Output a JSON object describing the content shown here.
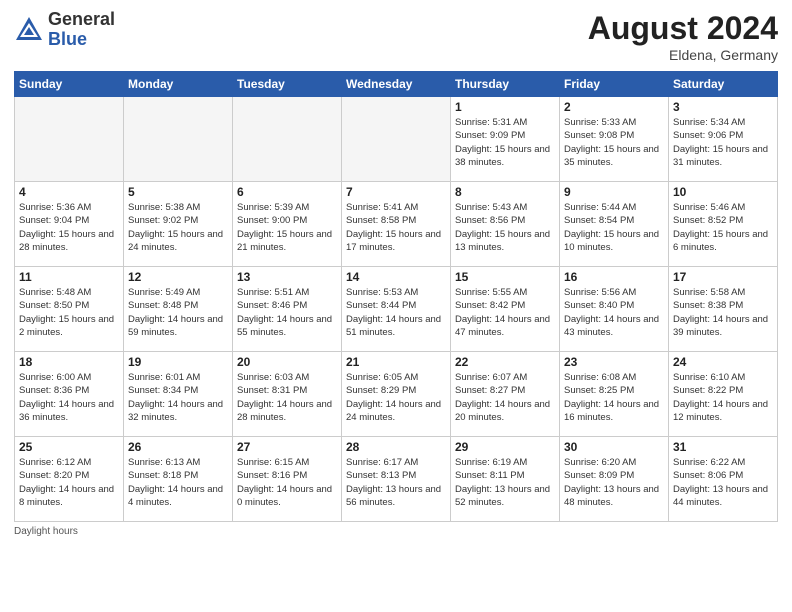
{
  "header": {
    "logo_general": "General",
    "logo_blue": "Blue",
    "month_year": "August 2024",
    "location": "Eldena, Germany"
  },
  "days_of_week": [
    "Sunday",
    "Monday",
    "Tuesday",
    "Wednesday",
    "Thursday",
    "Friday",
    "Saturday"
  ],
  "footer": {
    "note": "Daylight hours"
  },
  "weeks": [
    [
      {
        "day": "",
        "empty": true
      },
      {
        "day": "",
        "empty": true
      },
      {
        "day": "",
        "empty": true
      },
      {
        "day": "",
        "empty": true
      },
      {
        "day": "1",
        "sunrise": "Sunrise: 5:31 AM",
        "sunset": "Sunset: 9:09 PM",
        "daylight": "Daylight: 15 hours and 38 minutes."
      },
      {
        "day": "2",
        "sunrise": "Sunrise: 5:33 AM",
        "sunset": "Sunset: 9:08 PM",
        "daylight": "Daylight: 15 hours and 35 minutes."
      },
      {
        "day": "3",
        "sunrise": "Sunrise: 5:34 AM",
        "sunset": "Sunset: 9:06 PM",
        "daylight": "Daylight: 15 hours and 31 minutes."
      }
    ],
    [
      {
        "day": "4",
        "sunrise": "Sunrise: 5:36 AM",
        "sunset": "Sunset: 9:04 PM",
        "daylight": "Daylight: 15 hours and 28 minutes."
      },
      {
        "day": "5",
        "sunrise": "Sunrise: 5:38 AM",
        "sunset": "Sunset: 9:02 PM",
        "daylight": "Daylight: 15 hours and 24 minutes."
      },
      {
        "day": "6",
        "sunrise": "Sunrise: 5:39 AM",
        "sunset": "Sunset: 9:00 PM",
        "daylight": "Daylight: 15 hours and 21 minutes."
      },
      {
        "day": "7",
        "sunrise": "Sunrise: 5:41 AM",
        "sunset": "Sunset: 8:58 PM",
        "daylight": "Daylight: 15 hours and 17 minutes."
      },
      {
        "day": "8",
        "sunrise": "Sunrise: 5:43 AM",
        "sunset": "Sunset: 8:56 PM",
        "daylight": "Daylight: 15 hours and 13 minutes."
      },
      {
        "day": "9",
        "sunrise": "Sunrise: 5:44 AM",
        "sunset": "Sunset: 8:54 PM",
        "daylight": "Daylight: 15 hours and 10 minutes."
      },
      {
        "day": "10",
        "sunrise": "Sunrise: 5:46 AM",
        "sunset": "Sunset: 8:52 PM",
        "daylight": "Daylight: 15 hours and 6 minutes."
      }
    ],
    [
      {
        "day": "11",
        "sunrise": "Sunrise: 5:48 AM",
        "sunset": "Sunset: 8:50 PM",
        "daylight": "Daylight: 15 hours and 2 minutes."
      },
      {
        "day": "12",
        "sunrise": "Sunrise: 5:49 AM",
        "sunset": "Sunset: 8:48 PM",
        "daylight": "Daylight: 14 hours and 59 minutes."
      },
      {
        "day": "13",
        "sunrise": "Sunrise: 5:51 AM",
        "sunset": "Sunset: 8:46 PM",
        "daylight": "Daylight: 14 hours and 55 minutes."
      },
      {
        "day": "14",
        "sunrise": "Sunrise: 5:53 AM",
        "sunset": "Sunset: 8:44 PM",
        "daylight": "Daylight: 14 hours and 51 minutes."
      },
      {
        "day": "15",
        "sunrise": "Sunrise: 5:55 AM",
        "sunset": "Sunset: 8:42 PM",
        "daylight": "Daylight: 14 hours and 47 minutes."
      },
      {
        "day": "16",
        "sunrise": "Sunrise: 5:56 AM",
        "sunset": "Sunset: 8:40 PM",
        "daylight": "Daylight: 14 hours and 43 minutes."
      },
      {
        "day": "17",
        "sunrise": "Sunrise: 5:58 AM",
        "sunset": "Sunset: 8:38 PM",
        "daylight": "Daylight: 14 hours and 39 minutes."
      }
    ],
    [
      {
        "day": "18",
        "sunrise": "Sunrise: 6:00 AM",
        "sunset": "Sunset: 8:36 PM",
        "daylight": "Daylight: 14 hours and 36 minutes."
      },
      {
        "day": "19",
        "sunrise": "Sunrise: 6:01 AM",
        "sunset": "Sunset: 8:34 PM",
        "daylight": "Daylight: 14 hours and 32 minutes."
      },
      {
        "day": "20",
        "sunrise": "Sunrise: 6:03 AM",
        "sunset": "Sunset: 8:31 PM",
        "daylight": "Daylight: 14 hours and 28 minutes."
      },
      {
        "day": "21",
        "sunrise": "Sunrise: 6:05 AM",
        "sunset": "Sunset: 8:29 PM",
        "daylight": "Daylight: 14 hours and 24 minutes."
      },
      {
        "day": "22",
        "sunrise": "Sunrise: 6:07 AM",
        "sunset": "Sunset: 8:27 PM",
        "daylight": "Daylight: 14 hours and 20 minutes."
      },
      {
        "day": "23",
        "sunrise": "Sunrise: 6:08 AM",
        "sunset": "Sunset: 8:25 PM",
        "daylight": "Daylight: 14 hours and 16 minutes."
      },
      {
        "day": "24",
        "sunrise": "Sunrise: 6:10 AM",
        "sunset": "Sunset: 8:22 PM",
        "daylight": "Daylight: 14 hours and 12 minutes."
      }
    ],
    [
      {
        "day": "25",
        "sunrise": "Sunrise: 6:12 AM",
        "sunset": "Sunset: 8:20 PM",
        "daylight": "Daylight: 14 hours and 8 minutes."
      },
      {
        "day": "26",
        "sunrise": "Sunrise: 6:13 AM",
        "sunset": "Sunset: 8:18 PM",
        "daylight": "Daylight: 14 hours and 4 minutes."
      },
      {
        "day": "27",
        "sunrise": "Sunrise: 6:15 AM",
        "sunset": "Sunset: 8:16 PM",
        "daylight": "Daylight: 14 hours and 0 minutes."
      },
      {
        "day": "28",
        "sunrise": "Sunrise: 6:17 AM",
        "sunset": "Sunset: 8:13 PM",
        "daylight": "Daylight: 13 hours and 56 minutes."
      },
      {
        "day": "29",
        "sunrise": "Sunrise: 6:19 AM",
        "sunset": "Sunset: 8:11 PM",
        "daylight": "Daylight: 13 hours and 52 minutes."
      },
      {
        "day": "30",
        "sunrise": "Sunrise: 6:20 AM",
        "sunset": "Sunset: 8:09 PM",
        "daylight": "Daylight: 13 hours and 48 minutes."
      },
      {
        "day": "31",
        "sunrise": "Sunrise: 6:22 AM",
        "sunset": "Sunset: 8:06 PM",
        "daylight": "Daylight: 13 hours and 44 minutes."
      }
    ]
  ]
}
